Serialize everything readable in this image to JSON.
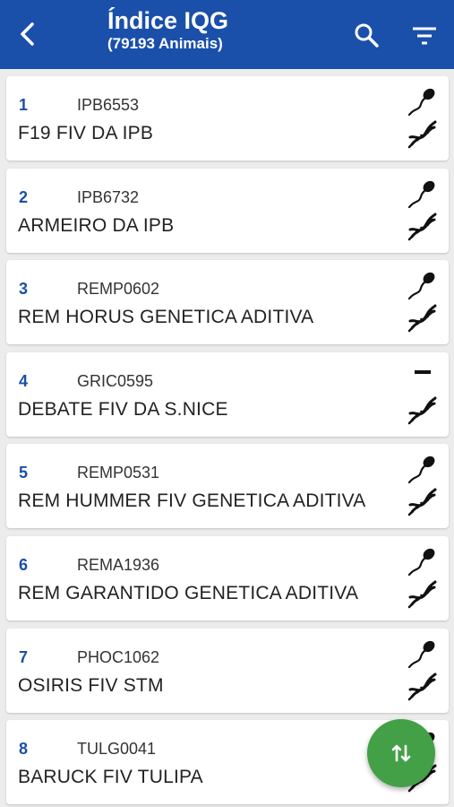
{
  "header": {
    "title": "Índice IQG",
    "subtitle": "(79193 Animais)",
    "back_icon": "arrow-left-icon",
    "search_icon": "search-icon",
    "filter_icon": "filter-icon"
  },
  "animals": [
    {
      "rank": "1",
      "code": "IPB6553",
      "name": "F19 FIV DA IPB",
      "semen": true
    },
    {
      "rank": "2",
      "code": "IPB6732",
      "name": "ARMEIRO DA IPB",
      "semen": true
    },
    {
      "rank": "3",
      "code": "REMP0602",
      "name": "REM HORUS GENETICA ADITIVA",
      "semen": true
    },
    {
      "rank": "4",
      "code": "GRIC0595",
      "name": "DEBATE FIV DA S.NICE",
      "semen": false
    },
    {
      "rank": "5",
      "code": "REMP0531",
      "name": "REM HUMMER FIV GENETICA ADITIVA",
      "semen": true
    },
    {
      "rank": "6",
      "code": "REMA1936",
      "name": "REM GARANTIDO GENETICA ADITIVA",
      "semen": true
    },
    {
      "rank": "7",
      "code": "PHOC1062",
      "name": "OSIRIS FIV STM",
      "semen": true
    },
    {
      "rank": "8",
      "code": "TULG0041",
      "name": "BARUCK FIV TULIPA",
      "semen": true
    }
  ],
  "fab": {
    "icon": "sort-swap-icon"
  },
  "colors": {
    "primary": "#1a4faa",
    "fab": "#43a047"
  }
}
